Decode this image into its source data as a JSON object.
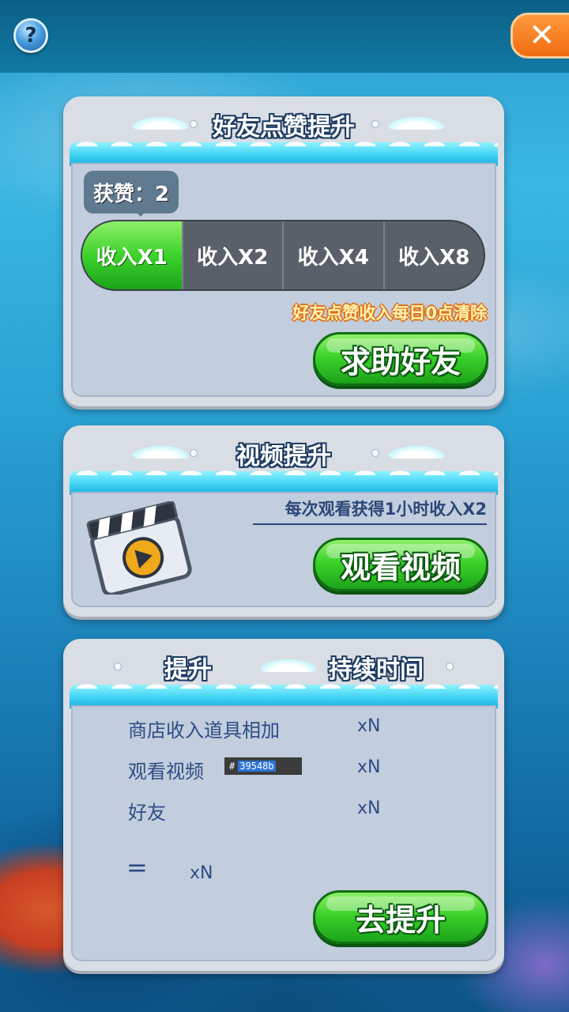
{
  "topbar": {
    "help_label": "?",
    "close_label": "✕"
  },
  "panel_friends": {
    "title": "好友点赞提升",
    "likes_label": "获赞：2",
    "tabs": [
      {
        "label": "收入X1",
        "active": true
      },
      {
        "label": "收入X2",
        "active": false
      },
      {
        "label": "收入X4",
        "active": false
      },
      {
        "label": "收入X8",
        "active": false
      }
    ],
    "note": "好友点赞收入每日0点清除",
    "button_label": "求助好友"
  },
  "panel_video": {
    "title": "视频提升",
    "note": "每次观看获得1小时收入X2",
    "icon": "clapperboard-play-icon",
    "button_label": "观看视频"
  },
  "panel_boost": {
    "title_left": "提升",
    "title_right": "持续时间",
    "rows": [
      {
        "label": "商店收入道具相加",
        "value": "xN"
      },
      {
        "label": "观看视频",
        "value": "xN"
      },
      {
        "label": "好友",
        "value": "xN"
      }
    ],
    "color_chip": {
      "prefix": "#",
      "value": "39548b"
    },
    "total_symbol": "=",
    "total_value": "xN",
    "button_label": "去提升"
  },
  "colors": {
    "accent_green": "#3dd22b",
    "title_outline": "#1e3c63",
    "text_blue": "#2e4d86",
    "close_orange": "#f06a10"
  }
}
